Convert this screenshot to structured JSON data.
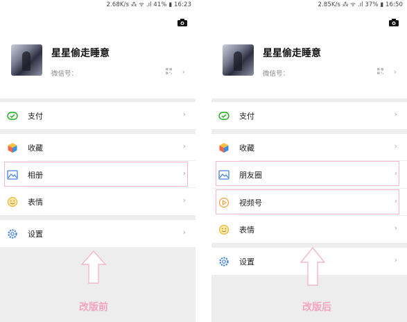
{
  "left": {
    "status": "2.68K/s ⁂ ᯤ .ıl 41% ▮ 16:23",
    "nickname": "星星偷走睡意",
    "wechat_id_label": "微信号：",
    "menu": {
      "pay": "支付",
      "favorites": "收藏",
      "album": "相册",
      "stickers": "表情",
      "settings": "设置"
    },
    "caption": "改版前"
  },
  "right": {
    "status": "2.85K/s ⁂ ᯤ .ıl 37% ▮ 16:50",
    "nickname": "星星偷走睡意",
    "wechat_id_label": "微信号：",
    "menu": {
      "pay": "支付",
      "favorites": "收藏",
      "moments": "朋友圈",
      "channels": "视频号",
      "stickers": "表情",
      "settings": "设置"
    },
    "caption": "改版后"
  },
  "colors": {
    "highlight": "#f4b7cb",
    "caption": "#f6a3bf",
    "pay_green": "#1aad19",
    "settings_blue": "#3f7fe0"
  },
  "chevron": "›"
}
